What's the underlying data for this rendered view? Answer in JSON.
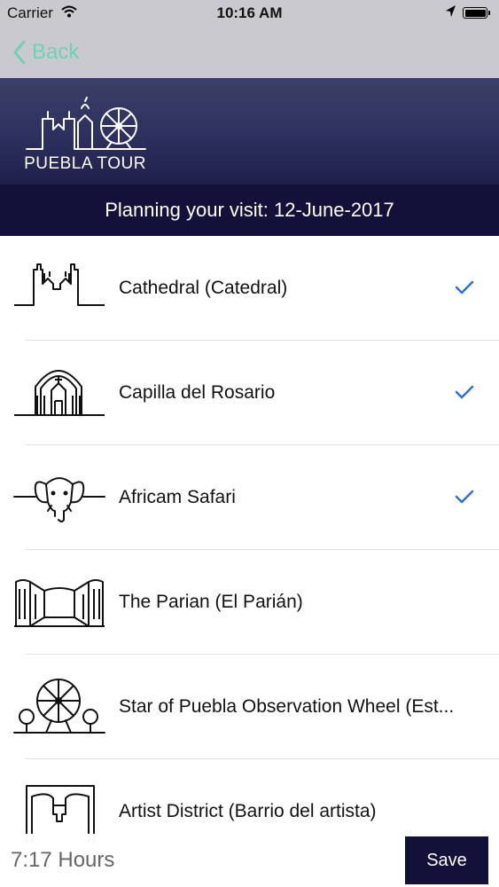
{
  "status_bar": {
    "carrier": "Carrier",
    "time": "10:16 AM",
    "icons": [
      "wifi-icon",
      "location-arrow-icon",
      "battery-icon"
    ]
  },
  "nav": {
    "back_label": "Back",
    "accent_color": "#6fd2b4"
  },
  "banner": {
    "logo_text": "PUEBLA TOUR",
    "plan_text": "Planning your visit: 12-June-2017"
  },
  "places": [
    {
      "name": "Cathedral (Catedral)",
      "icon": "cathedral-icon",
      "checked": true
    },
    {
      "name": "Capilla del Rosario",
      "icon": "chapel-icon",
      "checked": true
    },
    {
      "name": "Africam Safari",
      "icon": "elephant-icon",
      "checked": true
    },
    {
      "name": "The Parian (El Parián)",
      "icon": "market-icon",
      "checked": false
    },
    {
      "name": "Star of Puebla Observation Wheel (Est...",
      "icon": "ferris-wheel-icon",
      "checked": false
    },
    {
      "name": "Artist District (Barrio del artista)",
      "icon": "artist-district-icon",
      "checked": false
    }
  ],
  "footer": {
    "hours": "7:17 Hours",
    "save_label": "Save"
  },
  "colors": {
    "check": "#2d6fd6",
    "dark_navy": "#13103a"
  }
}
